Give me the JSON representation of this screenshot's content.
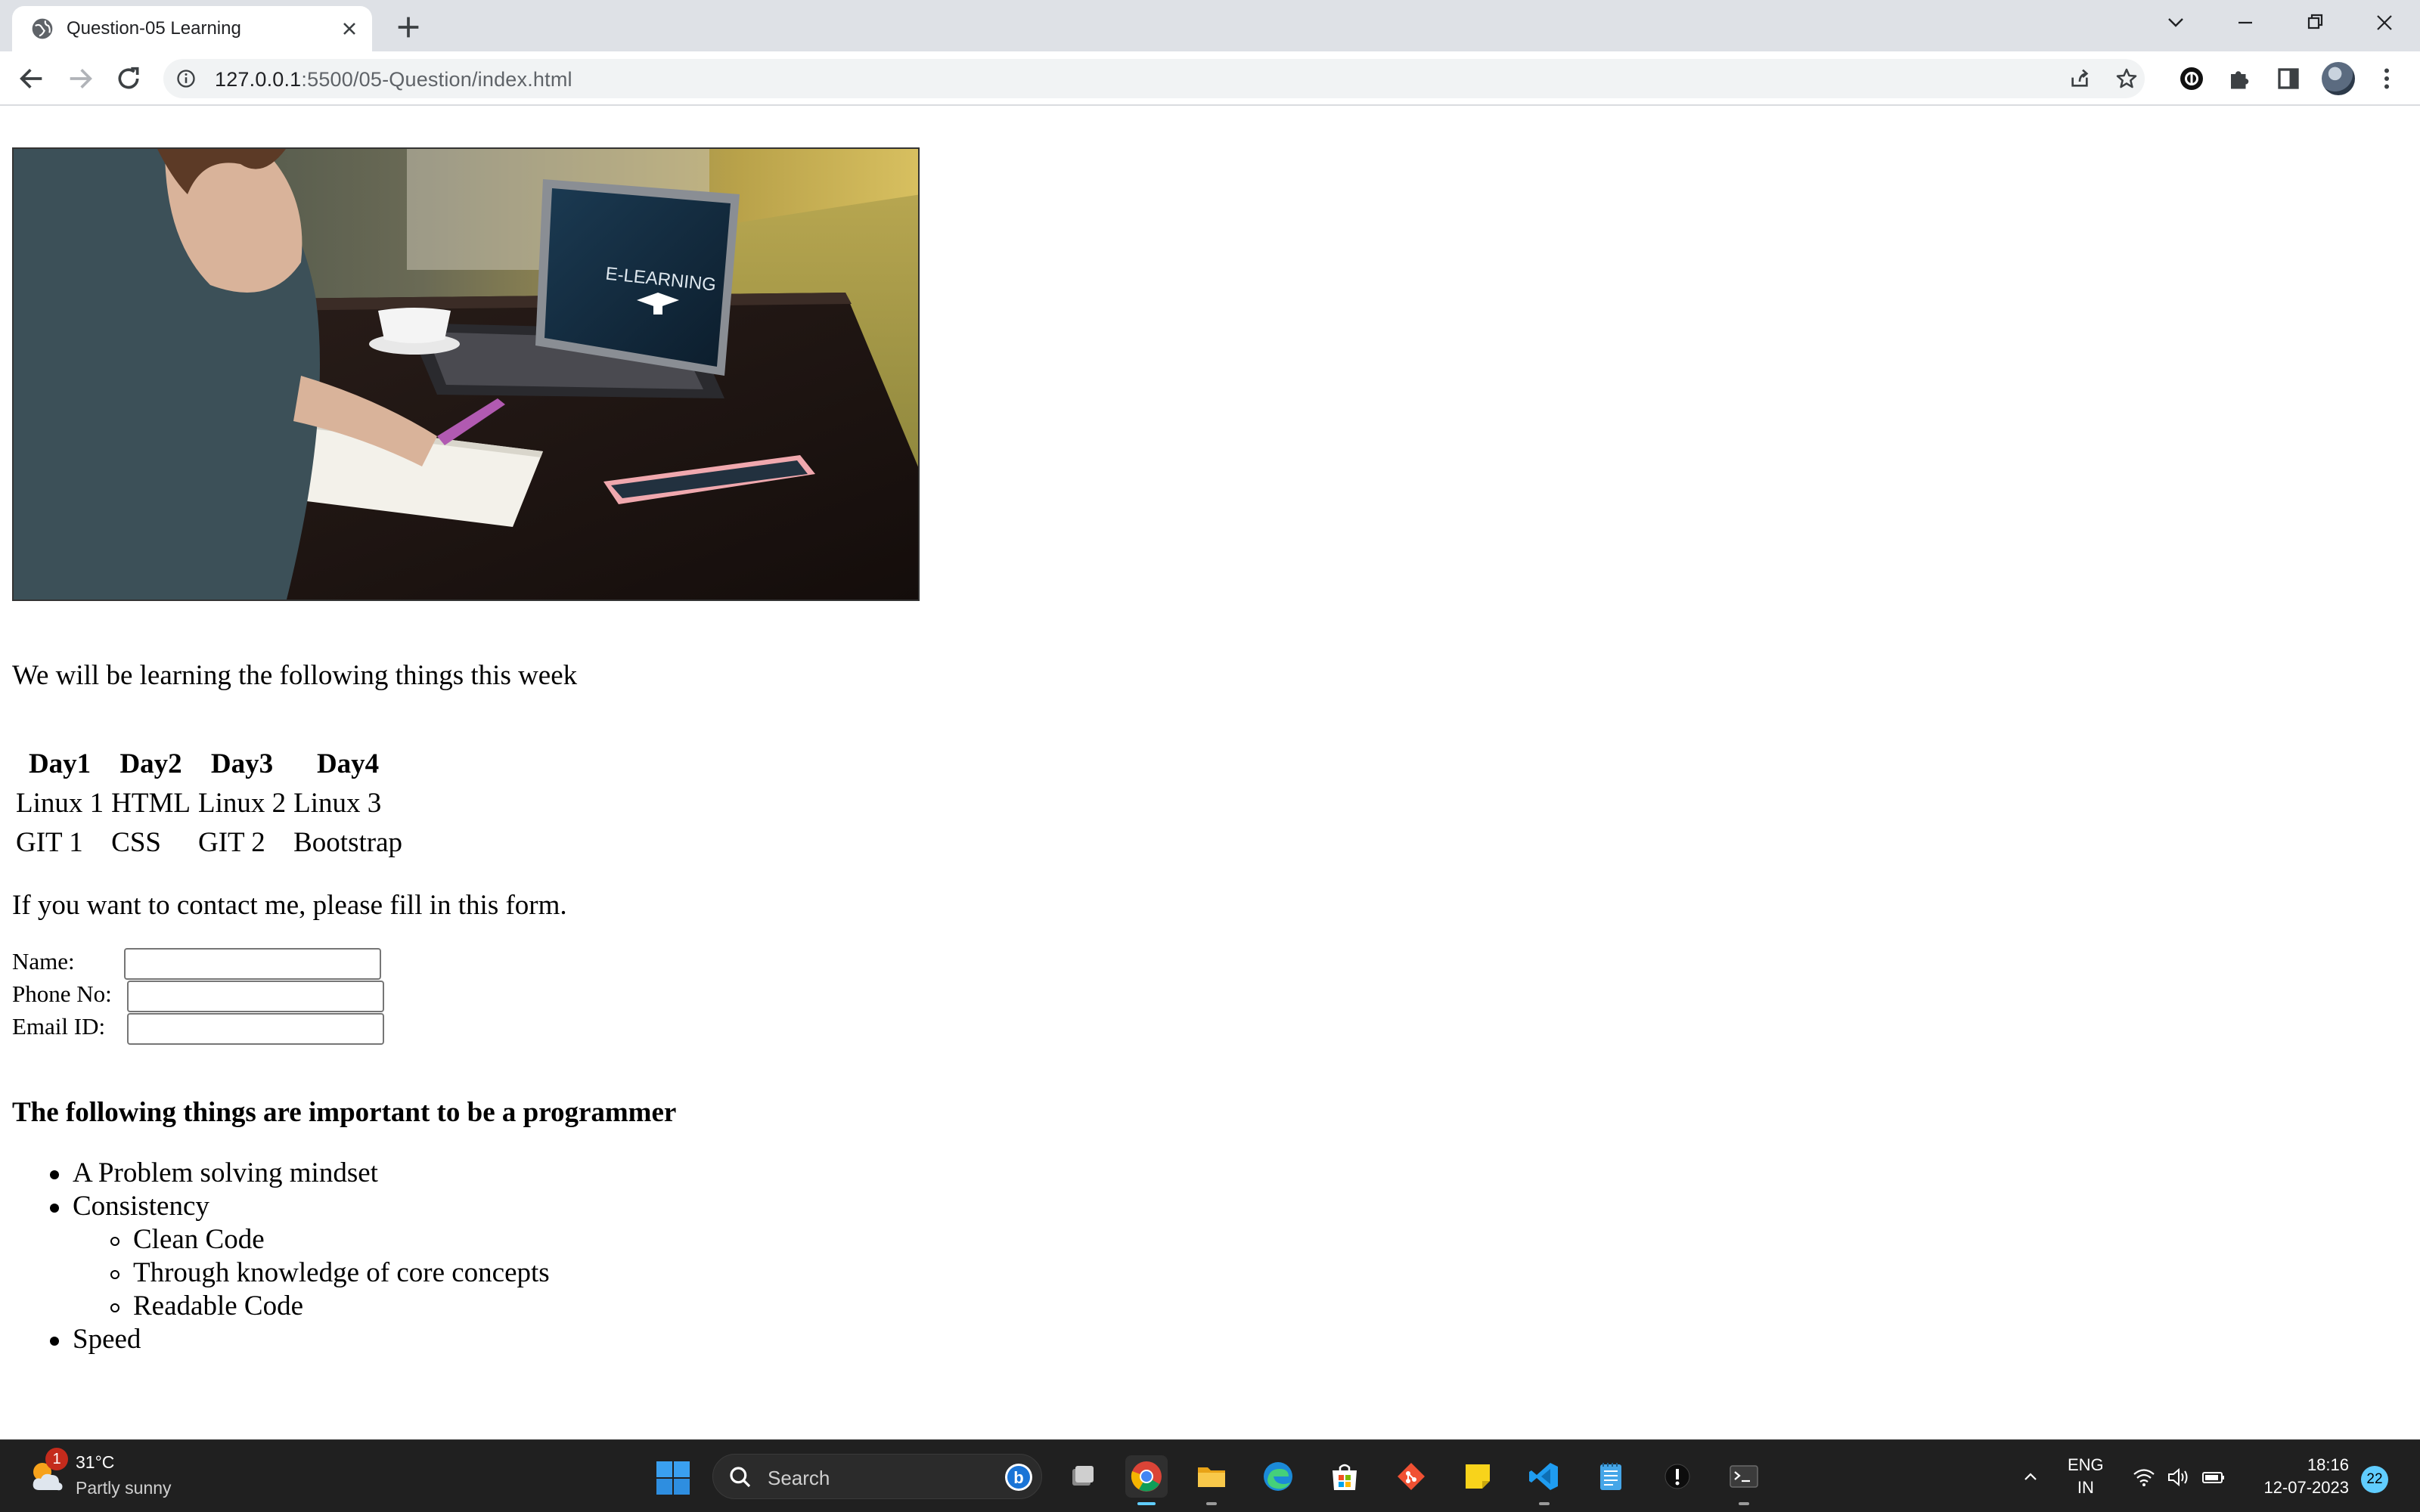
{
  "browser": {
    "tab_title": "Question-05 Learning",
    "url_host": "127.0.0.1",
    "url_path": ":5500/05-Question/index.html"
  },
  "page": {
    "hero_image": {
      "screen_text": "E-LEARNING"
    },
    "intro": "We will be learning the following things this week",
    "schedule": {
      "headers": [
        "Day1",
        "Day2",
        "Day3",
        "Day4"
      ],
      "rows": [
        [
          "Linux 1",
          "HTML",
          "Linux 2",
          "Linux 3"
        ],
        [
          "GIT 1",
          "CSS",
          "GIT 2",
          "Bootstrap"
        ]
      ]
    },
    "contact_text": "If you want to contact me, please fill in this form.",
    "form": {
      "name_label": "Name:",
      "phone_label": "Phone No:",
      "email_label": "Email ID:",
      "name_value": "",
      "phone_value": "",
      "email_value": ""
    },
    "important_heading": "The following things are important to be a programmer",
    "list": {
      "item1": "A Problem solving mindset",
      "item2": "Consistency",
      "sub1": "Clean Code",
      "sub2": "Through knowledge of core concepts",
      "sub3": "Readable Code",
      "item3": "Speed"
    }
  },
  "taskbar": {
    "weather_temp": "31°C",
    "weather_desc": "Partly sunny",
    "weather_badge": "1",
    "search_placeholder": "Search",
    "lang_line1": "ENG",
    "lang_line2": "IN",
    "time": "18:16",
    "date": "12-07-2023",
    "notification_count": "22"
  },
  "colors": {
    "tabbar_bg": "#dee1e6",
    "taskbar_bg": "#202020",
    "accent": "#60cdff"
  },
  "icons": [
    "globe-icon",
    "close-icon",
    "plus-icon",
    "chevron-down-icon",
    "minimize-icon",
    "restore-icon",
    "back-arrow-icon",
    "forward-arrow-icon",
    "reload-icon",
    "info-icon",
    "share-icon",
    "star-icon",
    "extension-icon",
    "puzzle-icon",
    "side-panel-icon",
    "menu-dots-icon",
    "windows-start-icon",
    "search-icon",
    "bing-icon",
    "wifi-icon",
    "volume-icon",
    "battery-icon"
  ]
}
